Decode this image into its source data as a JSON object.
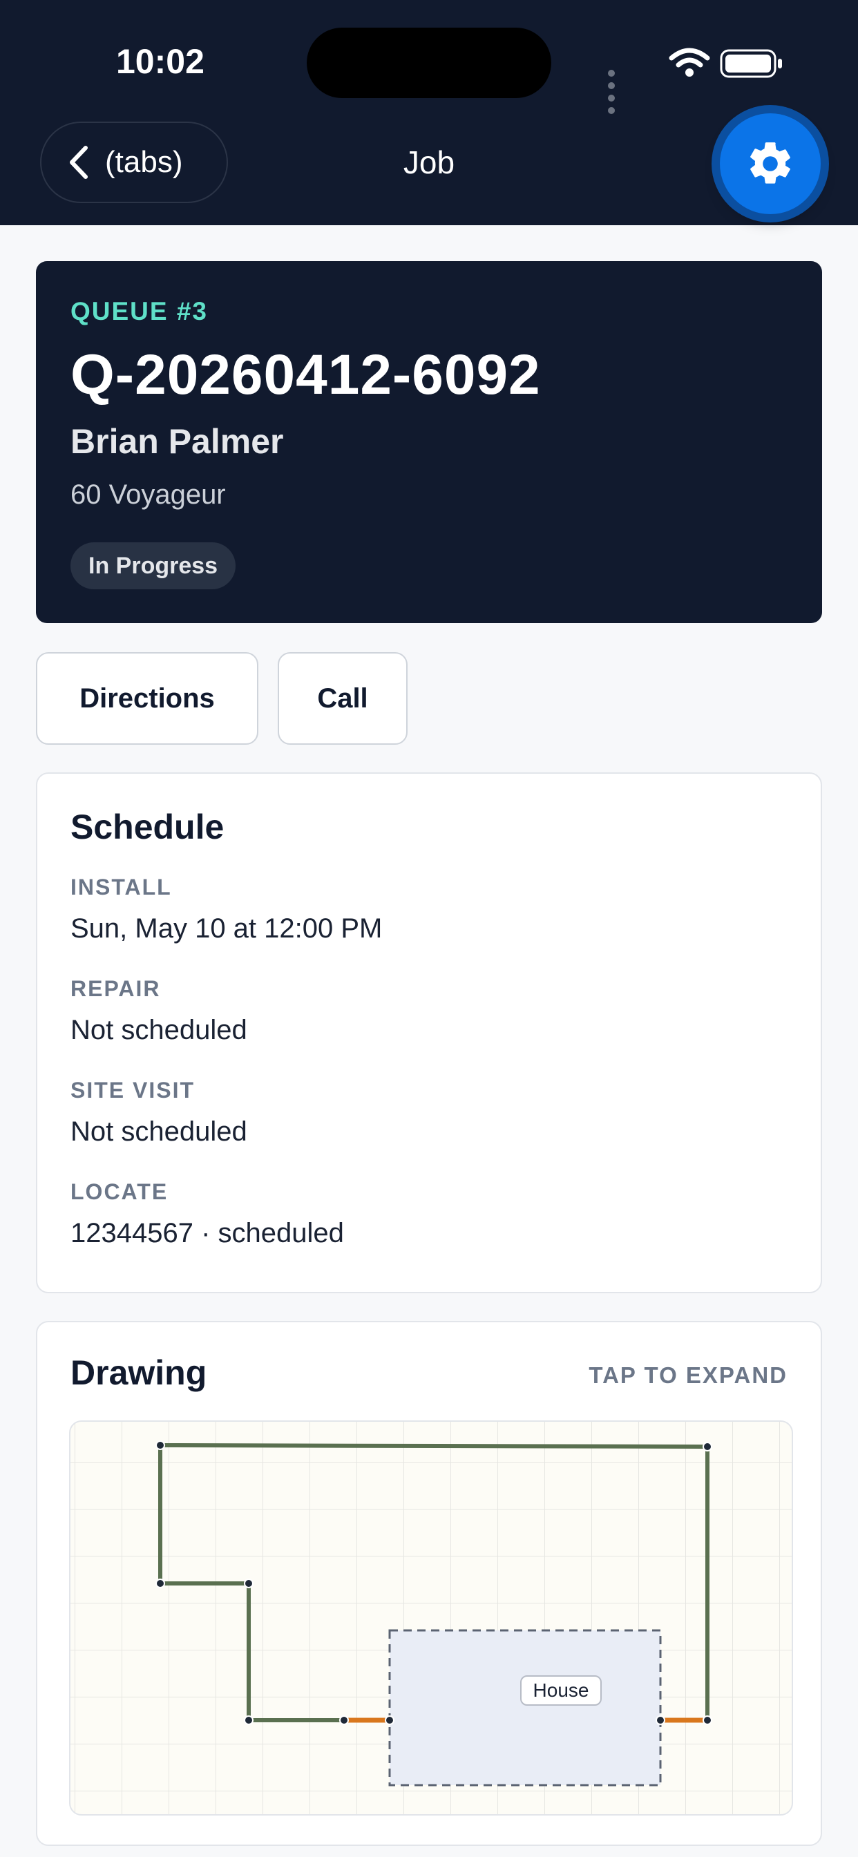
{
  "status_bar": {
    "time": "10:02"
  },
  "nav": {
    "back_label": "(tabs)",
    "title": "Job"
  },
  "job": {
    "queue": "QUEUE #3",
    "id": "Q-20260412-6092",
    "customer": "Brian Palmer",
    "address": "60 Voyageur",
    "status": "In Progress"
  },
  "actions": {
    "directions": "Directions",
    "call": "Call"
  },
  "schedule": {
    "title": "Schedule",
    "items": [
      {
        "label": "INSTALL",
        "value": "Sun, May 10 at 12:00 PM"
      },
      {
        "label": "REPAIR",
        "value": "Not scheduled"
      },
      {
        "label": "SITE VISIT",
        "value": "Not scheduled"
      },
      {
        "label": "LOCATE",
        "value": "12344567 · scheduled"
      }
    ]
  },
  "drawing": {
    "title": "Drawing",
    "expand_label": "TAP TO EXPAND",
    "house_label": "House"
  },
  "colors": {
    "header_bg": "#111a2e",
    "accent_teal": "#5fe0c8",
    "primary_blue": "#0b74e8",
    "fence_green": "#5a7050",
    "gate_orange": "#d9771d"
  }
}
